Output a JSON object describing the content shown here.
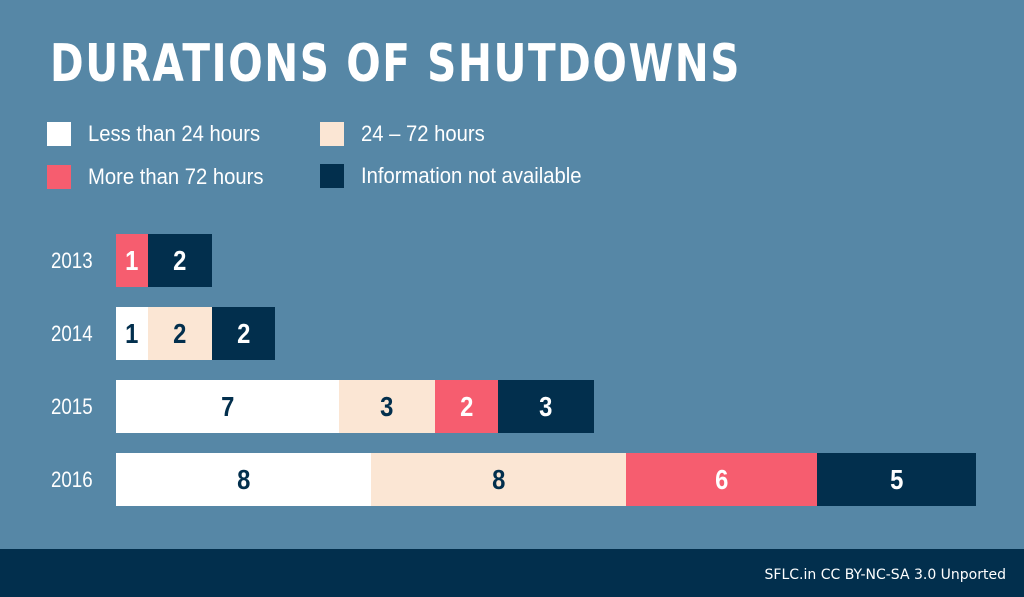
{
  "chart_data": {
    "type": "bar",
    "orientation": "horizontal",
    "stacked": true,
    "title": "DURATIONS OF SHUTDOWNS",
    "xlabel": "",
    "ylabel": "",
    "categories": [
      "2013",
      "2014",
      "2015",
      "2016"
    ],
    "series": [
      {
        "name": "Less than 24 hours",
        "color": "#ffffff",
        "label_color": "#022f4d",
        "values": [
          0,
          1,
          7,
          8
        ]
      },
      {
        "name": "24 – 72 hours",
        "color": "#fbe6d4",
        "label_color": "#022f4d",
        "values": [
          0,
          2,
          3,
          8
        ]
      },
      {
        "name": "More than 72 hours",
        "color": "#f65d6f",
        "label_color": "#ffffff",
        "values": [
          1,
          0,
          2,
          6
        ]
      },
      {
        "name": "Information not available",
        "color": "#022f4d",
        "label_color": "#ffffff",
        "values": [
          2,
          2,
          3,
          5
        ]
      }
    ],
    "xlim": [
      0,
      27
    ],
    "grid": false,
    "legend_position": "top-left"
  },
  "legend": [
    {
      "label": "Less than 24 hours"
    },
    {
      "label": "24 – 72 hours"
    },
    {
      "label": "More than 72 hours"
    },
    {
      "label": "Information not available"
    }
  ],
  "footer": {
    "credit": "SFLC.in CC BY-NC-SA 3.0 Unported",
    "background": "#022f4d"
  },
  "background": "#5687a6"
}
